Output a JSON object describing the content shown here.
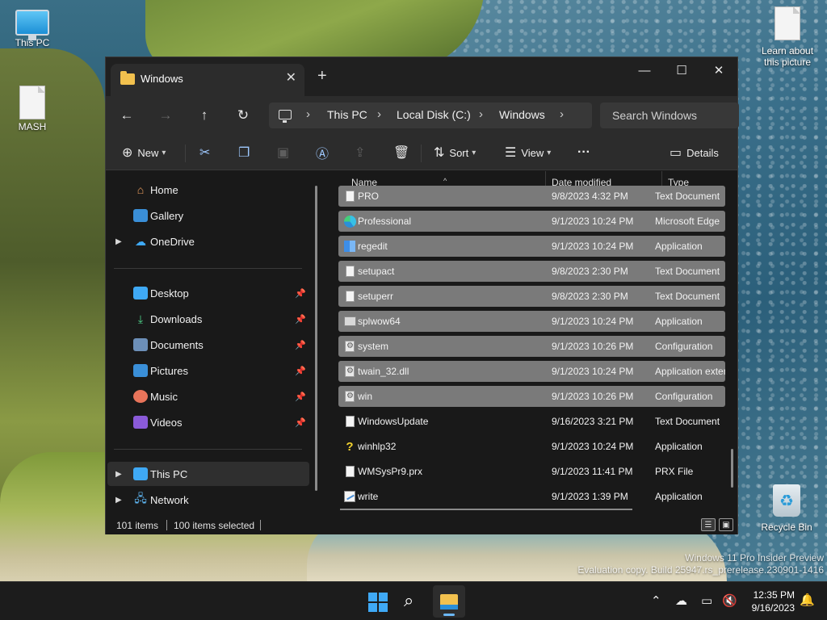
{
  "desktop": {
    "icons": [
      {
        "label": "This PC"
      },
      {
        "label": "MASH"
      },
      {
        "label": "Learn about this picture"
      },
      {
        "label": "Recycle Bin"
      }
    ],
    "watermark": {
      "line1": "Windows 11 Pro Insider Preview",
      "line2": "Evaluation copy. Build 25947.rs_prerelease.230901-1416"
    }
  },
  "window": {
    "tab_title": "Windows",
    "controls": {
      "minimize": "—",
      "maximize": "☐",
      "close": "✕"
    },
    "address": {
      "segments": [
        "This PC",
        "Local Disk (C:)",
        "Windows"
      ]
    },
    "search_placeholder": "Search Windows",
    "toolbar": {
      "new_label": "New",
      "sort_label": "Sort",
      "view_label": "View",
      "more_label": "···",
      "details_label": "Details"
    },
    "sidebar": {
      "top": [
        {
          "label": "Home",
          "icon": "home-icon"
        },
        {
          "label": "Gallery",
          "icon": "gallery-icon"
        },
        {
          "label": "OneDrive",
          "icon": "cloud-icon"
        }
      ],
      "quick": [
        {
          "label": "Desktop",
          "icon": "desktop-icon"
        },
        {
          "label": "Downloads",
          "icon": "download-icon"
        },
        {
          "label": "Documents",
          "icon": "documents-icon"
        },
        {
          "label": "Pictures",
          "icon": "pictures-icon"
        },
        {
          "label": "Music",
          "icon": "music-icon"
        },
        {
          "label": "Videos",
          "icon": "videos-icon"
        }
      ],
      "bottom": [
        {
          "label": "This PC",
          "icon": "pc-icon"
        },
        {
          "label": "Network",
          "icon": "network-icon"
        }
      ]
    },
    "columns": {
      "name": "Name",
      "date": "Date modified",
      "type": "Type"
    },
    "files": [
      {
        "name": "PRO",
        "date": "9/8/2023 4:32 PM",
        "type": "Text Document",
        "icon": "text-file-icon",
        "selected": true
      },
      {
        "name": "Professional",
        "date": "9/1/2023 10:24 PM",
        "type": "Microsoft Edge",
        "icon": "edge-icon",
        "selected": true
      },
      {
        "name": "regedit",
        "date": "9/1/2023 10:24 PM",
        "type": "Application",
        "icon": "regedit-icon",
        "selected": true
      },
      {
        "name": "setupact",
        "date": "9/8/2023 2:30 PM",
        "type": "Text Document",
        "icon": "text-file-icon",
        "selected": true
      },
      {
        "name": "setuperr",
        "date": "9/8/2023 2:30 PM",
        "type": "Text Document",
        "icon": "text-file-icon",
        "selected": true
      },
      {
        "name": "splwow64",
        "date": "9/1/2023 10:24 PM",
        "type": "Application",
        "icon": "printer-icon",
        "selected": true
      },
      {
        "name": "system",
        "date": "9/1/2023 10:26 PM",
        "type": "Configuration",
        "icon": "config-file-icon",
        "selected": true
      },
      {
        "name": "twain_32.dll",
        "date": "9/1/2023 10:24 PM",
        "type": "Application extension",
        "icon": "dll-file-icon",
        "selected": true
      },
      {
        "name": "win",
        "date": "9/1/2023 10:26 PM",
        "type": "Configuration",
        "icon": "config-file-icon",
        "selected": true
      },
      {
        "name": "WindowsUpdate",
        "date": "9/16/2023 3:21 PM",
        "type": "Text Document",
        "icon": "text-file-icon",
        "selected": false
      },
      {
        "name": "winhlp32",
        "date": "9/1/2023 10:24 PM",
        "type": "Application",
        "icon": "help-icon",
        "selected": false
      },
      {
        "name": "WMSysPr9.prx",
        "date": "9/1/2023 11:41 PM",
        "type": "PRX File",
        "icon": "blank-file-icon",
        "selected": false
      },
      {
        "name": "write",
        "date": "9/1/2023 1:39 PM",
        "type": "Application",
        "icon": "write-icon",
        "selected": false
      }
    ],
    "status": {
      "item_count": "101 items",
      "selected_count": "100 items selected"
    }
  },
  "taskbar": {
    "time": "12:35 PM",
    "date": "9/16/2023"
  }
}
